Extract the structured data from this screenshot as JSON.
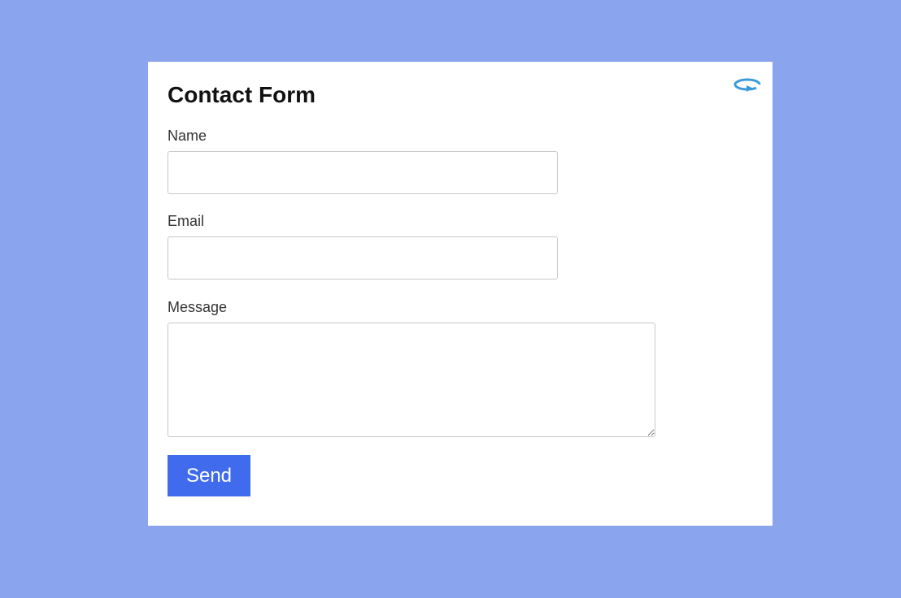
{
  "form": {
    "title": "Contact Form",
    "fields": {
      "name": {
        "label": "Name",
        "value": "",
        "placeholder": ""
      },
      "email": {
        "label": "Email",
        "value": "",
        "placeholder": ""
      },
      "message": {
        "label": "Message",
        "value": "",
        "placeholder": ""
      }
    },
    "send_label": "Send"
  },
  "icons": {
    "reset": "rotate-ccw-icon"
  },
  "colors": {
    "background": "#8aa5ee",
    "card": "#ffffff",
    "button": "#3f6bec",
    "icon": "#3a9bd8"
  }
}
